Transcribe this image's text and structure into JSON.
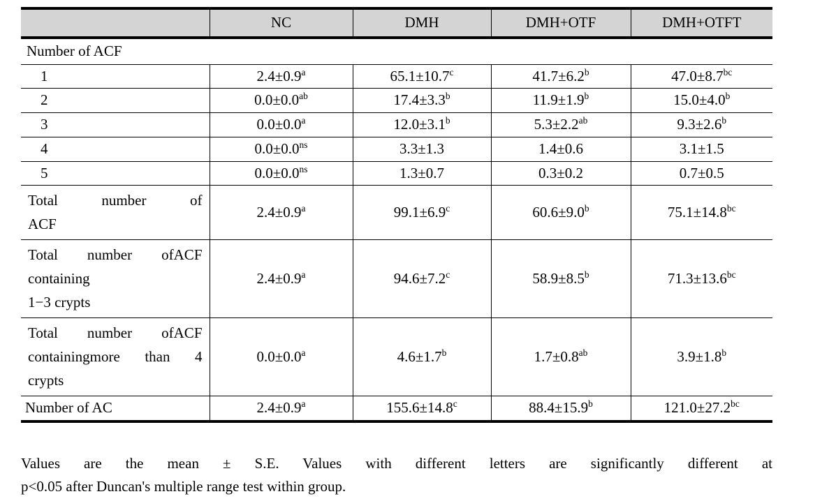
{
  "table": {
    "columns": [
      "",
      "NC",
      "DMH",
      "DMH+OTF",
      "DMH+OTFT"
    ],
    "header": {
      "label_col": "",
      "nc": "NC",
      "dmh": "DMH",
      "dmh_otf": "DMH+OTF",
      "dmh_otft": "DMH+OTFT"
    },
    "section_title": "Number of ACF",
    "rows": [
      {
        "label": "1",
        "nc": "2.4±0.9",
        "nc_sup": "a",
        "dmh": "65.1±10.7",
        "dmh_sup": "c",
        "otf": "41.7±6.2",
        "otf_sup": "b",
        "otft": "47.0±8.7",
        "otft_sup": "bc"
      },
      {
        "label": "2",
        "nc": "0.0±0.0",
        "nc_sup": "ab",
        "dmh": "17.4±3.3",
        "dmh_sup": "b",
        "otf": "11.9±1.9",
        "otf_sup": "b",
        "otft": "15.0±4.0",
        "otft_sup": "b"
      },
      {
        "label": "3",
        "nc": "0.0±0.0",
        "nc_sup": "a",
        "dmh": "12.0±3.1",
        "dmh_sup": "b",
        "otf": "5.3±2.2",
        "otf_sup": "ab",
        "otft": "9.3±2.6",
        "otft_sup": "b"
      },
      {
        "label": "4",
        "nc": "0.0±0.0",
        "nc_sup": "ns",
        "dmh": "3.3±1.3",
        "dmh_sup": "",
        "otf": "1.4±0.6",
        "otf_sup": "",
        "otft": "3.1±1.5",
        "otft_sup": ""
      },
      {
        "label": "5",
        "nc": "0.0±0.0",
        "nc_sup": "ns",
        "dmh": "1.3±0.7",
        "dmh_sup": "",
        "otf": "0.3±0.2",
        "otf_sup": "",
        "otft": "0.7±0.5",
        "otft_sup": ""
      }
    ],
    "total_acf": {
      "label_line1": "Total number of",
      "label_line2": "ACF",
      "nc": "2.4±0.9",
      "nc_sup": "a",
      "dmh": "99.1±6.9",
      "dmh_sup": "c",
      "otf": "60.6±9.0",
      "otf_sup": "b",
      "otft": "75.1±14.8",
      "otft_sup": "bc"
    },
    "total_acf_1_3": {
      "label_line1": "Total number of",
      "label_line2": "ACF containing",
      "label_line3": "1−3 crypts",
      "nc": "2.4±0.9",
      "nc_sup": "a",
      "dmh": "94.6±7.2",
      "dmh_sup": "c",
      "otf": "58.9±8.5",
      "otf_sup": "b",
      "otft": "71.3±13.6",
      "otft_sup": "bc"
    },
    "total_acf_more_4": {
      "label_line1": "Total number of",
      "label_line2": "ACF containing",
      "label_line3": "more than 4",
      "label_line4": "crypts",
      "nc": "0.0±0.0",
      "nc_sup": "a",
      "dmh": "4.6±1.7",
      "dmh_sup": "b",
      "otf": "1.7±0.8",
      "otf_sup": "ab",
      "otft": "3.9±1.8",
      "otft_sup": "b"
    },
    "number_of_ac": {
      "label": "Number of AC",
      "nc": "2.4±0.9",
      "nc_sup": "a",
      "dmh": "155.6±14.8",
      "dmh_sup": "c",
      "otf": "88.4±15.9",
      "otf_sup": "b",
      "otft": "121.0±27.2",
      "otft_sup": "bc"
    }
  },
  "footnote": {
    "line1": "Values are the mean ± S.E. Values with different letters are significantly different at",
    "line2": "p<0.05 after Duncan's multiple range test within group."
  },
  "colors": {
    "header_background": "#d4d4d4",
    "rule": "#000000",
    "text": "#000000",
    "page_background": "#ffffff"
  }
}
